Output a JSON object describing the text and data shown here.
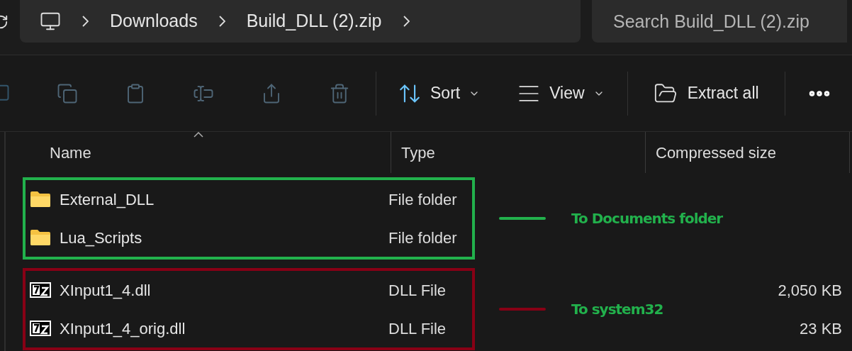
{
  "breadcrumb": [
    "Downloads",
    "Build_DLL (2).zip"
  ],
  "search": {
    "placeholder": "Search Build_DLL (2).zip"
  },
  "toolbar": {
    "actions": [
      {
        "kind": "copy",
        "disabled": true
      },
      {
        "kind": "paste",
        "disabled": true
      },
      {
        "kind": "rename",
        "disabled": true
      },
      {
        "kind": "share",
        "disabled": true
      },
      {
        "kind": "delete",
        "disabled": true
      }
    ],
    "sort": "Sort",
    "view": "View",
    "extract": "Extract all"
  },
  "columns": [
    {
      "label": "Name",
      "sorted": true
    },
    {
      "label": "Type",
      "sorted": false
    },
    {
      "label": "Compressed size",
      "sorted": false
    }
  ],
  "groups": [
    {
      "color": "#22b14c",
      "note": "To Documents folder",
      "rows": [
        {
          "kind": "folder",
          "name": "External_DLL",
          "type": "File folder"
        },
        {
          "kind": "folder",
          "name": "Lua_Scripts",
          "type": "File folder"
        }
      ]
    },
    {
      "color": "#880015",
      "note": "To system32",
      "rows": [
        {
          "kind": "archive",
          "name": "XInput1_4.dll",
          "type": "DLL File",
          "size": "2,050 KB"
        },
        {
          "kind": "archive",
          "name": "XInput1_4_orig.dll",
          "type": "DLL File",
          "size": "23 KB"
        }
      ]
    }
  ]
}
